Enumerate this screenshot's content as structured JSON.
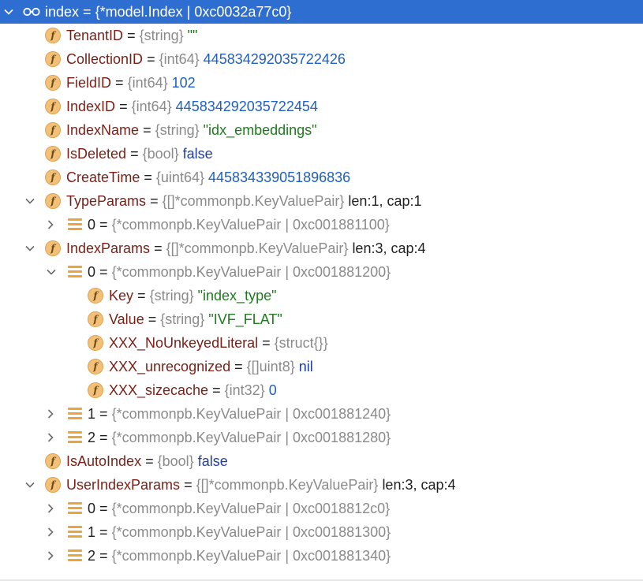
{
  "rows": [
    {
      "name": "index",
      "eq": "=",
      "type": "{*model.Index | 0xc0032a77c0}",
      "value": "",
      "extra": "",
      "icon": "glasses-icon",
      "expander": "expanded"
    },
    {
      "name": "TenantID",
      "eq": "=",
      "type": "{string}",
      "value": "\"\"",
      "extra": "",
      "icon": "field-icon",
      "expander": ""
    },
    {
      "name": "CollectionID",
      "eq": "=",
      "type": "{int64}",
      "value": "445834292035722426",
      "extra": "",
      "icon": "field-icon",
      "expander": ""
    },
    {
      "name": "FieldID",
      "eq": "=",
      "type": "{int64}",
      "value": "102",
      "extra": "",
      "icon": "field-icon",
      "expander": ""
    },
    {
      "name": "IndexID",
      "eq": "=",
      "type": "{int64}",
      "value": "445834292035722454",
      "extra": "",
      "icon": "field-icon",
      "expander": ""
    },
    {
      "name": "IndexName",
      "eq": "=",
      "type": "{string}",
      "value": "\"idx_embeddings\"",
      "extra": "",
      "icon": "field-icon",
      "expander": ""
    },
    {
      "name": "IsDeleted",
      "eq": "=",
      "type": "{bool}",
      "value": "false",
      "extra": "",
      "icon": "field-icon",
      "expander": ""
    },
    {
      "name": "CreateTime",
      "eq": "=",
      "type": "{uint64}",
      "value": "445834339051896836",
      "extra": "",
      "icon": "field-icon",
      "expander": ""
    },
    {
      "name": "TypeParams",
      "eq": "=",
      "type": "{[]*commonpb.KeyValuePair}",
      "value": "",
      "extra": "len:1, cap:1",
      "icon": "field-icon",
      "expander": "expanded"
    },
    {
      "name": "0",
      "eq": "=",
      "type": "{*commonpb.KeyValuePair | 0xc001881100}",
      "value": "",
      "extra": "",
      "icon": "list-icon",
      "expander": "collapsed"
    },
    {
      "name": "IndexParams",
      "eq": "=",
      "type": "{[]*commonpb.KeyValuePair}",
      "value": "",
      "extra": "len:3, cap:4",
      "icon": "field-icon",
      "expander": "expanded"
    },
    {
      "name": "0",
      "eq": "=",
      "type": "{*commonpb.KeyValuePair | 0xc001881200}",
      "value": "",
      "extra": "",
      "icon": "list-icon",
      "expander": "expanded"
    },
    {
      "name": "Key",
      "eq": "=",
      "type": "{string}",
      "value": "\"index_type\"",
      "extra": "",
      "icon": "field-icon",
      "expander": ""
    },
    {
      "name": "Value",
      "eq": "=",
      "type": "{string}",
      "value": "\"IVF_FLAT\"",
      "extra": "",
      "icon": "field-icon",
      "expander": ""
    },
    {
      "name": "XXX_NoUnkeyedLiteral",
      "eq": "=",
      "type": "{struct{}}",
      "value": "",
      "extra": "",
      "icon": "field-icon",
      "expander": ""
    },
    {
      "name": "XXX_unrecognized",
      "eq": "=",
      "type": "{[]uint8}",
      "value": "nil",
      "extra": "",
      "icon": "field-icon",
      "expander": ""
    },
    {
      "name": "XXX_sizecache",
      "eq": "=",
      "type": "{int32}",
      "value": "0",
      "extra": "",
      "icon": "field-icon",
      "expander": ""
    },
    {
      "name": "1",
      "eq": "=",
      "type": "{*commonpb.KeyValuePair | 0xc001881240}",
      "value": "",
      "extra": "",
      "icon": "list-icon",
      "expander": "collapsed"
    },
    {
      "name": "2",
      "eq": "=",
      "type": "{*commonpb.KeyValuePair | 0xc001881280}",
      "value": "",
      "extra": "",
      "icon": "list-icon",
      "expander": "collapsed"
    },
    {
      "name": "IsAutoIndex",
      "eq": "=",
      "type": "{bool}",
      "value": "false",
      "extra": "",
      "icon": "field-icon",
      "expander": ""
    },
    {
      "name": "UserIndexParams",
      "eq": "=",
      "type": "{[]*commonpb.KeyValuePair}",
      "value": "",
      "extra": "len:3, cap:4",
      "icon": "field-icon",
      "expander": "expanded"
    },
    {
      "name": "0",
      "eq": "=",
      "type": "{*commonpb.KeyValuePair | 0xc0018812c0}",
      "value": "",
      "extra": "",
      "icon": "list-icon",
      "expander": "collapsed"
    },
    {
      "name": "1",
      "eq": "=",
      "type": "{*commonpb.KeyValuePair | 0xc001881300}",
      "value": "",
      "extra": "",
      "icon": "list-icon",
      "expander": "collapsed"
    },
    {
      "name": "2",
      "eq": "=",
      "type": "{*commonpb.KeyValuePair | 0xc001881340}",
      "value": "",
      "extra": "",
      "icon": "list-icon",
      "expander": "collapsed"
    }
  ],
  "field_icon_letter": "f",
  "colors": {
    "selection": "#2f6ed1",
    "field_name": "#7a1f16",
    "type_text": "#8a8a8a",
    "number_value": "#1e5fc1",
    "string_value": "#1f7a1f",
    "keyword_value": "#1f3ea8"
  }
}
